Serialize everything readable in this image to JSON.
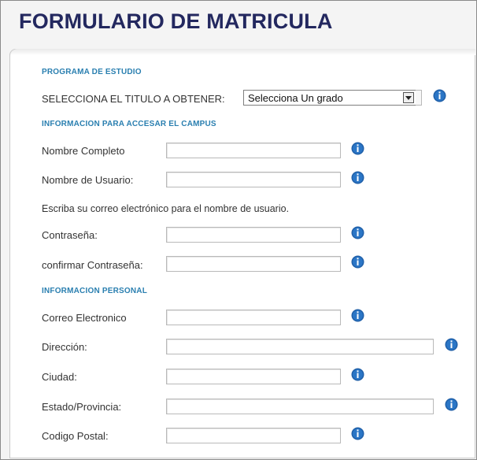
{
  "page": {
    "title": "FORMULARIO DE MATRICULA"
  },
  "program": {
    "section_title": "PROGRAMA DE ESTUDIO",
    "degree_label": "SELECCIONA EL TITULO A OBTENER:",
    "degree_selected": "Selecciona Un grado"
  },
  "campus": {
    "section_title": "INFORMACION PARA ACCESAR EL CAMPUS",
    "full_name_label": "Nombre Completo",
    "username_label": "Nombre de Usuario:",
    "username_note": "Escriba su correo electrónico para el nombre de usuario.",
    "password_label": "Contraseña:",
    "confirm_password_label": "confirmar Contraseña:"
  },
  "personal": {
    "section_title": "INFORMACION PERSONAL",
    "email_label": "Correo Electronico",
    "address_label": "Dirección:",
    "city_label": "Ciudad:",
    "state_label": "Estado/Provincia:",
    "zip_label": "Codigo Postal:"
  },
  "icons": {
    "info": "info-icon",
    "dropdown": "chevron-down-icon"
  },
  "colors": {
    "title": "#23285f",
    "section": "#2a7fb0",
    "info_icon": "#1f5fa8"
  }
}
